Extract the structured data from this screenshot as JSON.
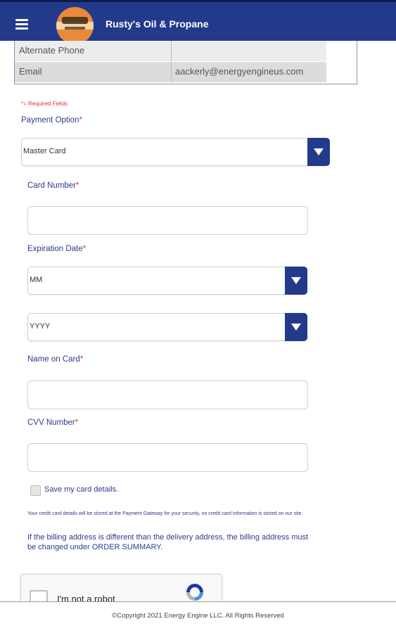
{
  "header": {
    "title": "Rusty's Oil & Propane",
    "menu_icon": "hamburger-icon",
    "logo_icon": "company-logo",
    "bg_color": "#233a8b"
  },
  "contact": {
    "rows": [
      {
        "label": "Alternate Phone",
        "value": ""
      },
      {
        "label": "Email",
        "value": "aackerly@energyengineus.com"
      }
    ]
  },
  "form": {
    "required_note": "*= Required Fields",
    "payment_option": {
      "label": "Payment Option",
      "value": "Master Card"
    },
    "card_number": {
      "label": "Card Number",
      "value": ""
    },
    "expiration": {
      "label": "Expiration Date",
      "month_value": "MM",
      "year_value": "YYYY"
    },
    "name_on_card": {
      "label": "Name on Card",
      "value": ""
    },
    "cvv": {
      "label": "CVV Number",
      "value": ""
    },
    "save_card": {
      "label": "Save my card details.",
      "checked": false
    },
    "notice_small": "Your credit card details will be stored at the Payment Gateway for your security, no credit card information is stored on our site.",
    "notice": "If the billing address is different than the delivery address, the billing address must be changed under ORDER SUMMARY."
  },
  "captcha": {
    "label": "I'm not a robot",
    "icon": "recaptcha-icon"
  },
  "footer": {
    "copyright": "©Copyright 2021 Energy Engine LLC. All Rights Reserved"
  },
  "colors": {
    "accent": "#233a8b",
    "required": "#e03434",
    "label": "#2e3a8c"
  }
}
